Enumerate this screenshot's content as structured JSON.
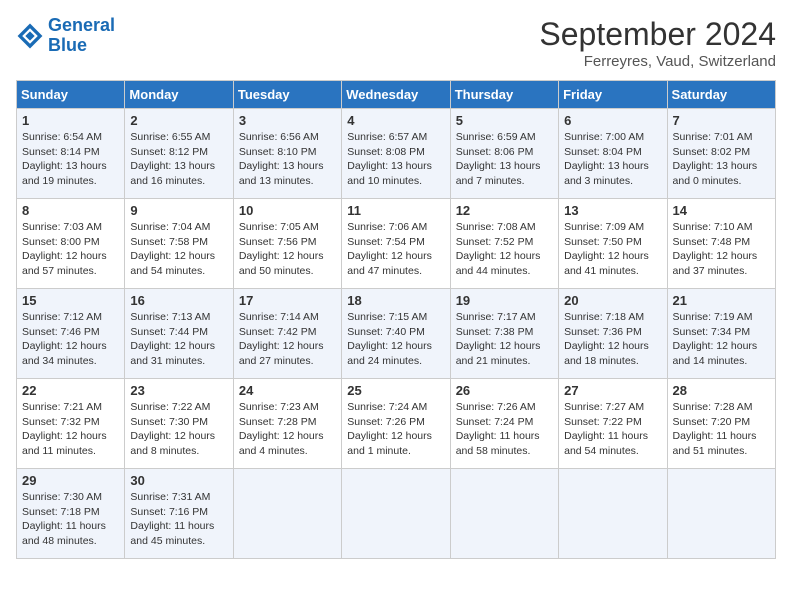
{
  "header": {
    "logo_general": "General",
    "logo_blue": "Blue",
    "month_title": "September 2024",
    "location": "Ferreyres, Vaud, Switzerland"
  },
  "weekdays": [
    "Sunday",
    "Monday",
    "Tuesday",
    "Wednesday",
    "Thursday",
    "Friday",
    "Saturday"
  ],
  "weeks": [
    [
      {
        "day": "1",
        "sunrise": "6:54 AM",
        "sunset": "8:14 PM",
        "daylight": "13 hours and 19 minutes."
      },
      {
        "day": "2",
        "sunrise": "6:55 AM",
        "sunset": "8:12 PM",
        "daylight": "13 hours and 16 minutes."
      },
      {
        "day": "3",
        "sunrise": "6:56 AM",
        "sunset": "8:10 PM",
        "daylight": "13 hours and 13 minutes."
      },
      {
        "day": "4",
        "sunrise": "6:57 AM",
        "sunset": "8:08 PM",
        "daylight": "13 hours and 10 minutes."
      },
      {
        "day": "5",
        "sunrise": "6:59 AM",
        "sunset": "8:06 PM",
        "daylight": "13 hours and 7 minutes."
      },
      {
        "day": "6",
        "sunrise": "7:00 AM",
        "sunset": "8:04 PM",
        "daylight": "13 hours and 3 minutes."
      },
      {
        "day": "7",
        "sunrise": "7:01 AM",
        "sunset": "8:02 PM",
        "daylight": "13 hours and 0 minutes."
      }
    ],
    [
      {
        "day": "8",
        "sunrise": "7:03 AM",
        "sunset": "8:00 PM",
        "daylight": "12 hours and 57 minutes."
      },
      {
        "day": "9",
        "sunrise": "7:04 AM",
        "sunset": "7:58 PM",
        "daylight": "12 hours and 54 minutes."
      },
      {
        "day": "10",
        "sunrise": "7:05 AM",
        "sunset": "7:56 PM",
        "daylight": "12 hours and 50 minutes."
      },
      {
        "day": "11",
        "sunrise": "7:06 AM",
        "sunset": "7:54 PM",
        "daylight": "12 hours and 47 minutes."
      },
      {
        "day": "12",
        "sunrise": "7:08 AM",
        "sunset": "7:52 PM",
        "daylight": "12 hours and 44 minutes."
      },
      {
        "day": "13",
        "sunrise": "7:09 AM",
        "sunset": "7:50 PM",
        "daylight": "12 hours and 41 minutes."
      },
      {
        "day": "14",
        "sunrise": "7:10 AM",
        "sunset": "7:48 PM",
        "daylight": "12 hours and 37 minutes."
      }
    ],
    [
      {
        "day": "15",
        "sunrise": "7:12 AM",
        "sunset": "7:46 PM",
        "daylight": "12 hours and 34 minutes."
      },
      {
        "day": "16",
        "sunrise": "7:13 AM",
        "sunset": "7:44 PM",
        "daylight": "12 hours and 31 minutes."
      },
      {
        "day": "17",
        "sunrise": "7:14 AM",
        "sunset": "7:42 PM",
        "daylight": "12 hours and 27 minutes."
      },
      {
        "day": "18",
        "sunrise": "7:15 AM",
        "sunset": "7:40 PM",
        "daylight": "12 hours and 24 minutes."
      },
      {
        "day": "19",
        "sunrise": "7:17 AM",
        "sunset": "7:38 PM",
        "daylight": "12 hours and 21 minutes."
      },
      {
        "day": "20",
        "sunrise": "7:18 AM",
        "sunset": "7:36 PM",
        "daylight": "12 hours and 18 minutes."
      },
      {
        "day": "21",
        "sunrise": "7:19 AM",
        "sunset": "7:34 PM",
        "daylight": "12 hours and 14 minutes."
      }
    ],
    [
      {
        "day": "22",
        "sunrise": "7:21 AM",
        "sunset": "7:32 PM",
        "daylight": "12 hours and 11 minutes."
      },
      {
        "day": "23",
        "sunrise": "7:22 AM",
        "sunset": "7:30 PM",
        "daylight": "12 hours and 8 minutes."
      },
      {
        "day": "24",
        "sunrise": "7:23 AM",
        "sunset": "7:28 PM",
        "daylight": "12 hours and 4 minutes."
      },
      {
        "day": "25",
        "sunrise": "7:24 AM",
        "sunset": "7:26 PM",
        "daylight": "12 hours and 1 minute."
      },
      {
        "day": "26",
        "sunrise": "7:26 AM",
        "sunset": "7:24 PM",
        "daylight": "11 hours and 58 minutes."
      },
      {
        "day": "27",
        "sunrise": "7:27 AM",
        "sunset": "7:22 PM",
        "daylight": "11 hours and 54 minutes."
      },
      {
        "day": "28",
        "sunrise": "7:28 AM",
        "sunset": "7:20 PM",
        "daylight": "11 hours and 51 minutes."
      }
    ],
    [
      {
        "day": "29",
        "sunrise": "7:30 AM",
        "sunset": "7:18 PM",
        "daylight": "11 hours and 48 minutes."
      },
      {
        "day": "30",
        "sunrise": "7:31 AM",
        "sunset": "7:16 PM",
        "daylight": "11 hours and 45 minutes."
      },
      null,
      null,
      null,
      null,
      null
    ]
  ],
  "labels": {
    "sunrise": "Sunrise:",
    "sunset": "Sunset:",
    "daylight": "Daylight:"
  }
}
